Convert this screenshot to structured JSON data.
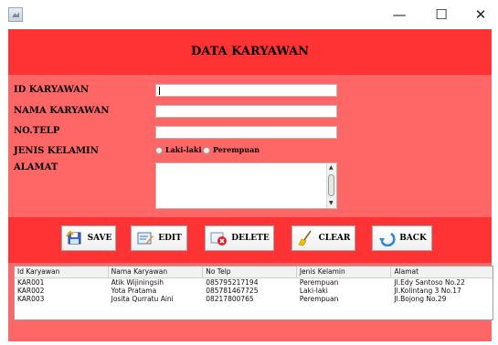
{
  "window": {
    "minimize_glyph": "—",
    "maximize_glyph": "☐",
    "close_glyph": "✕"
  },
  "header": {
    "title": "DATA KARYAWAN"
  },
  "form": {
    "id_label": "ID KARYAWAN",
    "nama_label": "NAMA KARYAWAN",
    "telp_label": "NO.TELP",
    "jk_label": "JENIS KELAMIN",
    "alamat_label": "ALAMAT",
    "id_value": "",
    "nama_value": "",
    "telp_value": "",
    "alamat_value": "",
    "radio_male": "Laki-laki",
    "radio_female": "Perempuan"
  },
  "buttons": {
    "save": "SAVE",
    "edit": "EDIT",
    "delete": "DELETE",
    "clear": "CLEAR",
    "back": "BACK"
  },
  "table": {
    "headers": [
      "Id Karyawan",
      "Nama Karyawan",
      "No Telp",
      "Jenis Kelamin",
      "Alamat"
    ],
    "rows": [
      [
        "KAR001",
        "Atik Wijiningsih",
        "085795217194",
        "Perempuan",
        "Jl.Edy Santoso No.22"
      ],
      [
        "KAR002",
        "Yota Pratama",
        "085781467725",
        "Laki-laki",
        "Jl.Kolintang 3 No.17"
      ],
      [
        "KAR003",
        "Josita Qurratu Aini",
        "08217800765",
        "Perempuan",
        "Jl.Bojong No.29"
      ]
    ]
  },
  "colors": {
    "panel": "#ff6666",
    "bars": "#ff3333"
  },
  "icons": {
    "save": "save-floppy-icon",
    "edit": "edit-icon",
    "delete": "delete-icon",
    "clear": "broom-icon",
    "back": "back-arrow-icon"
  }
}
